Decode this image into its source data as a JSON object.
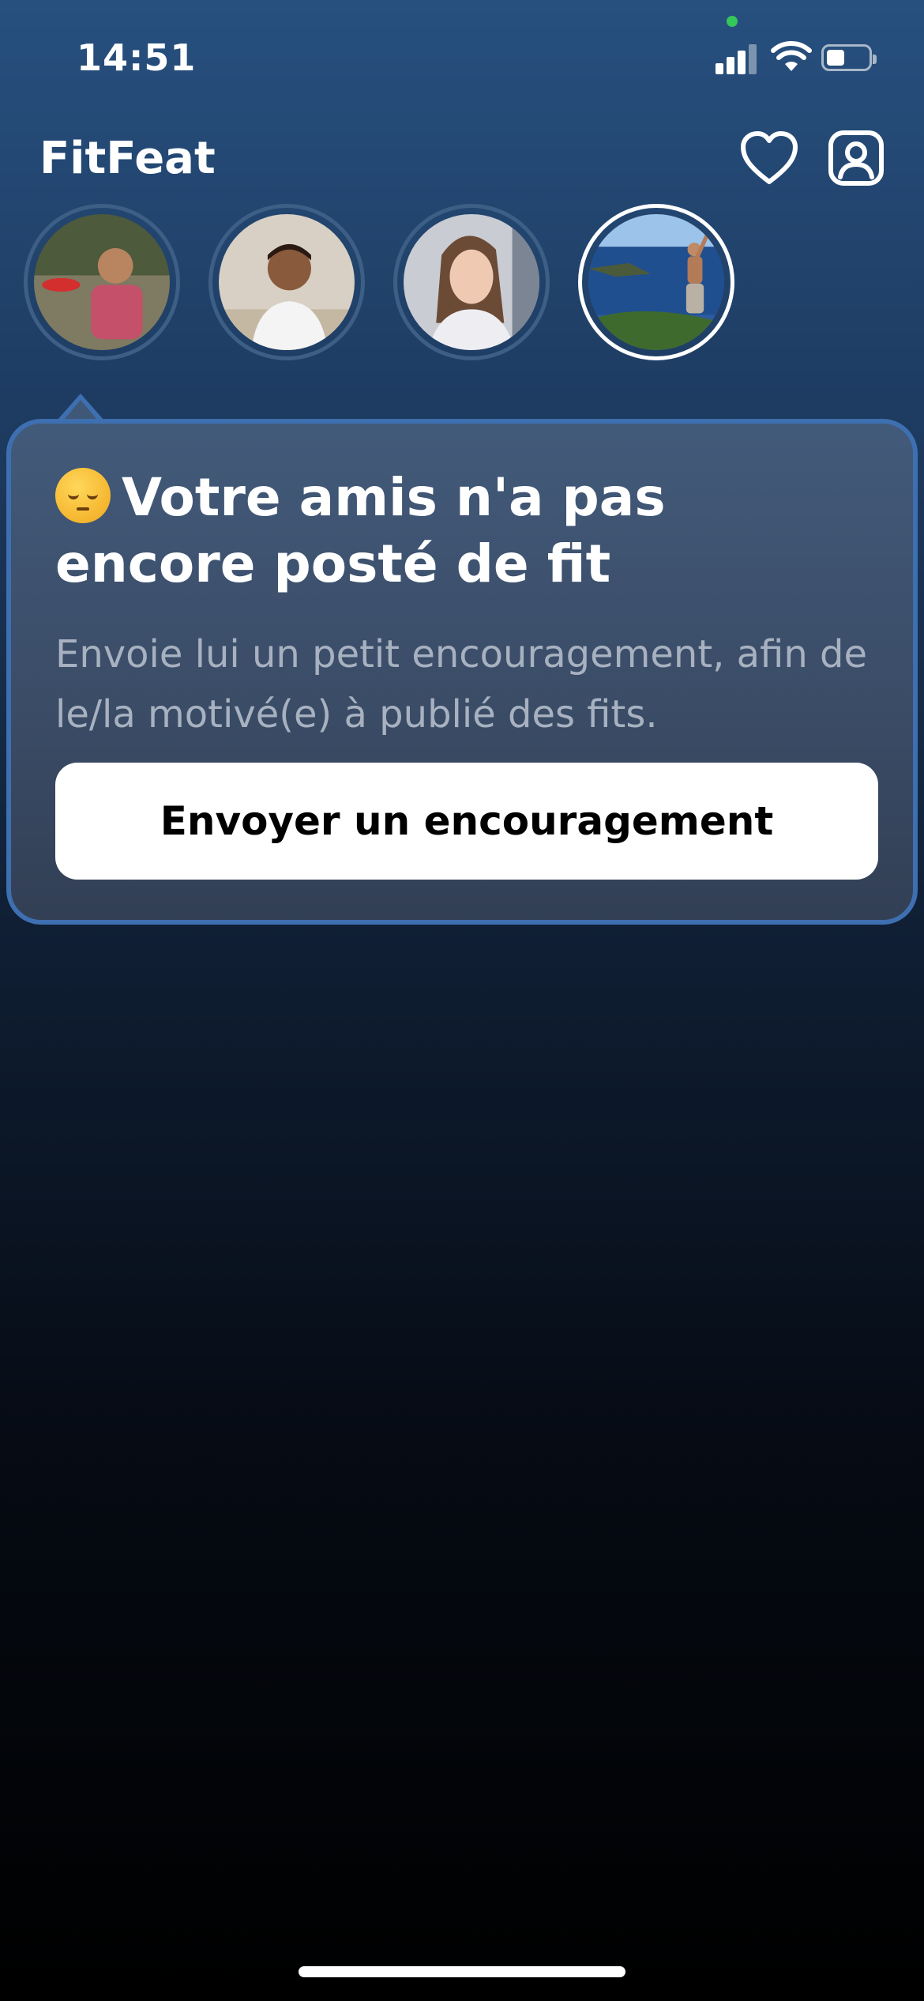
{
  "status_bar": {
    "time": "14:51"
  },
  "header": {
    "app_title": "FitFeat"
  },
  "stories": [
    {
      "name": "friend-1"
    },
    {
      "name": "friend-2"
    },
    {
      "name": "friend-3"
    },
    {
      "name": "friend-4",
      "selected": true
    }
  ],
  "card": {
    "title": "Votre amis n'a pas encore posté de fit",
    "description": "Envoie lui un petit encouragement, afin de le/la motivé(e) à publié des fits.",
    "button_label": "Envoyer un encouragement"
  },
  "colors": {
    "accent_border": "#3e6fb0",
    "background_top": "#27507f",
    "background_bottom": "#000000",
    "card_background": "#3f5878",
    "button_background": "#ffffff"
  },
  "icons": {
    "status": [
      "cellular-signal-icon",
      "wifi-icon",
      "battery-icon"
    ],
    "header": [
      "heart-icon",
      "profile-icon"
    ],
    "card_emoji": "pensive-face-emoji"
  }
}
